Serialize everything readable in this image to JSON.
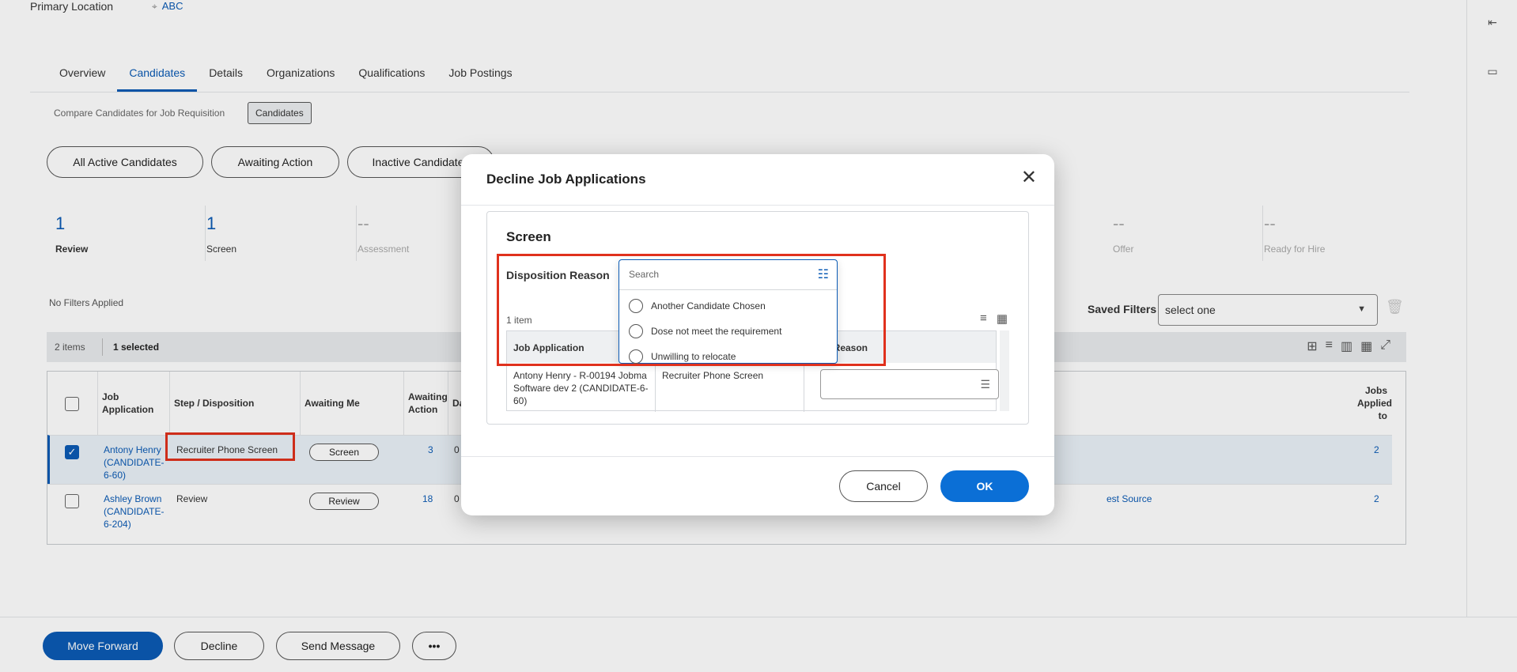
{
  "header": {
    "primary_location_label": "Primary Location",
    "primary_location_value": "ABC"
  },
  "tabs": [
    "Overview",
    "Candidates",
    "Details",
    "Organizations",
    "Qualifications",
    "Job Postings"
  ],
  "active_tab": "Candidates",
  "compare": {
    "text": "Compare Candidates for Job Requisition",
    "chip": "Candidates"
  },
  "filter_pills": [
    "All Active Candidates",
    "Awaiting Action",
    "Inactive Candidates"
  ],
  "stages": [
    {
      "count": "1",
      "label": "Review"
    },
    {
      "count": "1",
      "label": "Screen"
    },
    {
      "count": "--",
      "label": "Assessment"
    },
    {
      "count": "--",
      "label": "Offer"
    },
    {
      "count": "--",
      "label": "Ready for Hire"
    }
  ],
  "filters": {
    "no_filters": "No Filters Applied",
    "saved_label": "Saved Filters",
    "saved_value": "select one"
  },
  "grid": {
    "items": "2 items",
    "selected": "1 selected",
    "headers": {
      "job_application": "Job Application",
      "step": "Step / Disposition",
      "awaiting_me": "Awaiting Me",
      "awaiting_action": "Awaiting Action",
      "date_prefix": "Da",
      "jobs_applied": "Jobs Applied to"
    },
    "rows": [
      {
        "name": "Antony Henry (CANDIDATE-6-60)",
        "step": "Recruiter Phone Screen",
        "action": "Screen",
        "awaiting": "3",
        "date_prefix": "0",
        "source": "",
        "jobs": "2",
        "checked": true
      },
      {
        "name": "Ashley Brown (CANDIDATE-6-204)",
        "step": "Review",
        "action": "Review",
        "awaiting": "18",
        "date_prefix": "0",
        "source": "est Source",
        "jobs": "2",
        "checked": false
      }
    ]
  },
  "footer": {
    "move_forward": "Move Forward",
    "decline": "Decline",
    "send_message": "Send Message",
    "more": "•••"
  },
  "modal": {
    "title": "Decline Job Applications",
    "section_title": "Screen",
    "disposition_label": "Disposition Reason",
    "search_placeholder": "Search",
    "options": [
      "Another Candidate Chosen",
      "Dose not meet the requirement",
      "Unwilling to relocate"
    ],
    "item_count": "1 item",
    "table_headers": {
      "job_application": "Job Application",
      "step": "",
      "reason": "ition Reason"
    },
    "row": {
      "job_application": "Antony Henry - R-00194 Jobma Software dev 2 (CANDIDATE-6-60)",
      "step": "Recruiter Phone Screen"
    },
    "cancel": "Cancel",
    "ok": "OK"
  },
  "colors": {
    "accent": "#0b5bb5",
    "highlight": "#e0311d",
    "ok_button": "#0b6fd6"
  }
}
